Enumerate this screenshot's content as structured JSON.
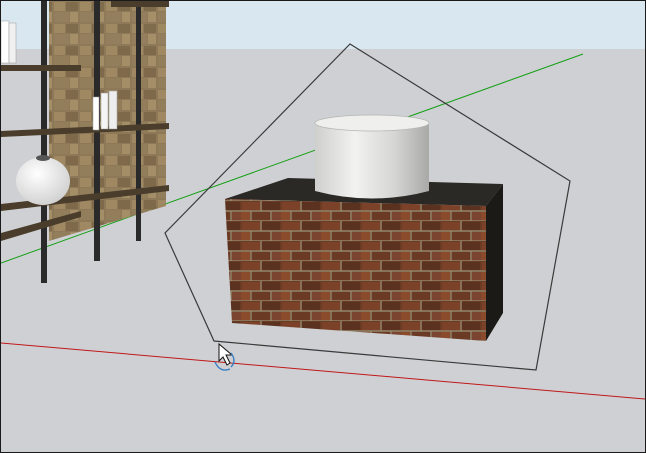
{
  "scene": {
    "colors": {
      "sky": "#d9e7f1",
      "ground": "#cfd0d4",
      "axis_red": "#c01818",
      "axis_green": "#15a015",
      "selection_outline": "#3a3a3a",
      "block_top": "#2b2925",
      "block_side": "#1c1a17",
      "brick_base": "#6b3b24",
      "mortar": "#9a9278",
      "cylinder_light": "#f0f0ef",
      "cylinder_shade": "#a9a9a7",
      "shelf_frame": "#2a2a2a",
      "shelf_board": "#5a4a33",
      "stone_wall": "#8a7450",
      "vase": "#f4f4f4",
      "cursor_blue": "#3b7fc4"
    },
    "objects": [
      {
        "name": "brick-block",
        "material": "brick"
      },
      {
        "name": "cylinder",
        "material": "white-marble"
      },
      {
        "name": "bookshelf",
        "material": "dark-metal"
      },
      {
        "name": "stone-wall",
        "material": "stone"
      },
      {
        "name": "vase",
        "material": "white-ceramic"
      }
    ],
    "selection": {
      "shape": "pentagon",
      "selected": "brick-block"
    },
    "cursor": {
      "tool": "orbit-icon"
    }
  }
}
